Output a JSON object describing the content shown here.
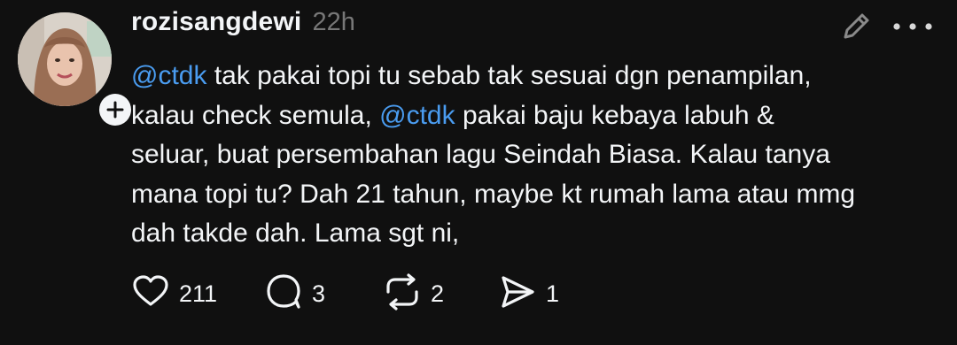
{
  "post": {
    "username": "rozisangdewi",
    "timestamp": "22h",
    "body": {
      "segments": [
        {
          "type": "mention",
          "text": "@ctdk"
        },
        {
          "type": "text",
          "text": " tak pakai topi tu sebab tak sesuai dgn penampilan,"
        },
        {
          "type": "break"
        },
        {
          "type": "text",
          "text": "kalau check semula, "
        },
        {
          "type": "mention",
          "text": "@ctdk"
        },
        {
          "type": "text",
          "text": " pakai baju kebaya labuh &"
        },
        {
          "type": "break"
        },
        {
          "type": "text",
          "text": "seluar, buat persembahan lagu Seindah Biasa. Kalau tanya"
        },
        {
          "type": "break"
        },
        {
          "type": "text",
          "text": "mana topi tu? Dah 21 tahun, maybe kt rumah lama atau mmg"
        },
        {
          "type": "break"
        },
        {
          "type": "text",
          "text": "dah takde dah. Lama sgt ni,"
        }
      ]
    },
    "actions": {
      "likes": "211",
      "replies": "3",
      "reposts": "2",
      "shares": "1"
    }
  },
  "icons": {
    "follow": "plus-icon",
    "edit": "pencil-icon",
    "more": "more-horizontal-icon",
    "like": "heart-icon",
    "reply": "comment-bubble-icon",
    "repost": "repost-icon",
    "share": "send-icon"
  },
  "colors": {
    "background": "#101010",
    "text": "#f3f5f7",
    "muted": "#777777",
    "mention": "#4a9cf0"
  }
}
